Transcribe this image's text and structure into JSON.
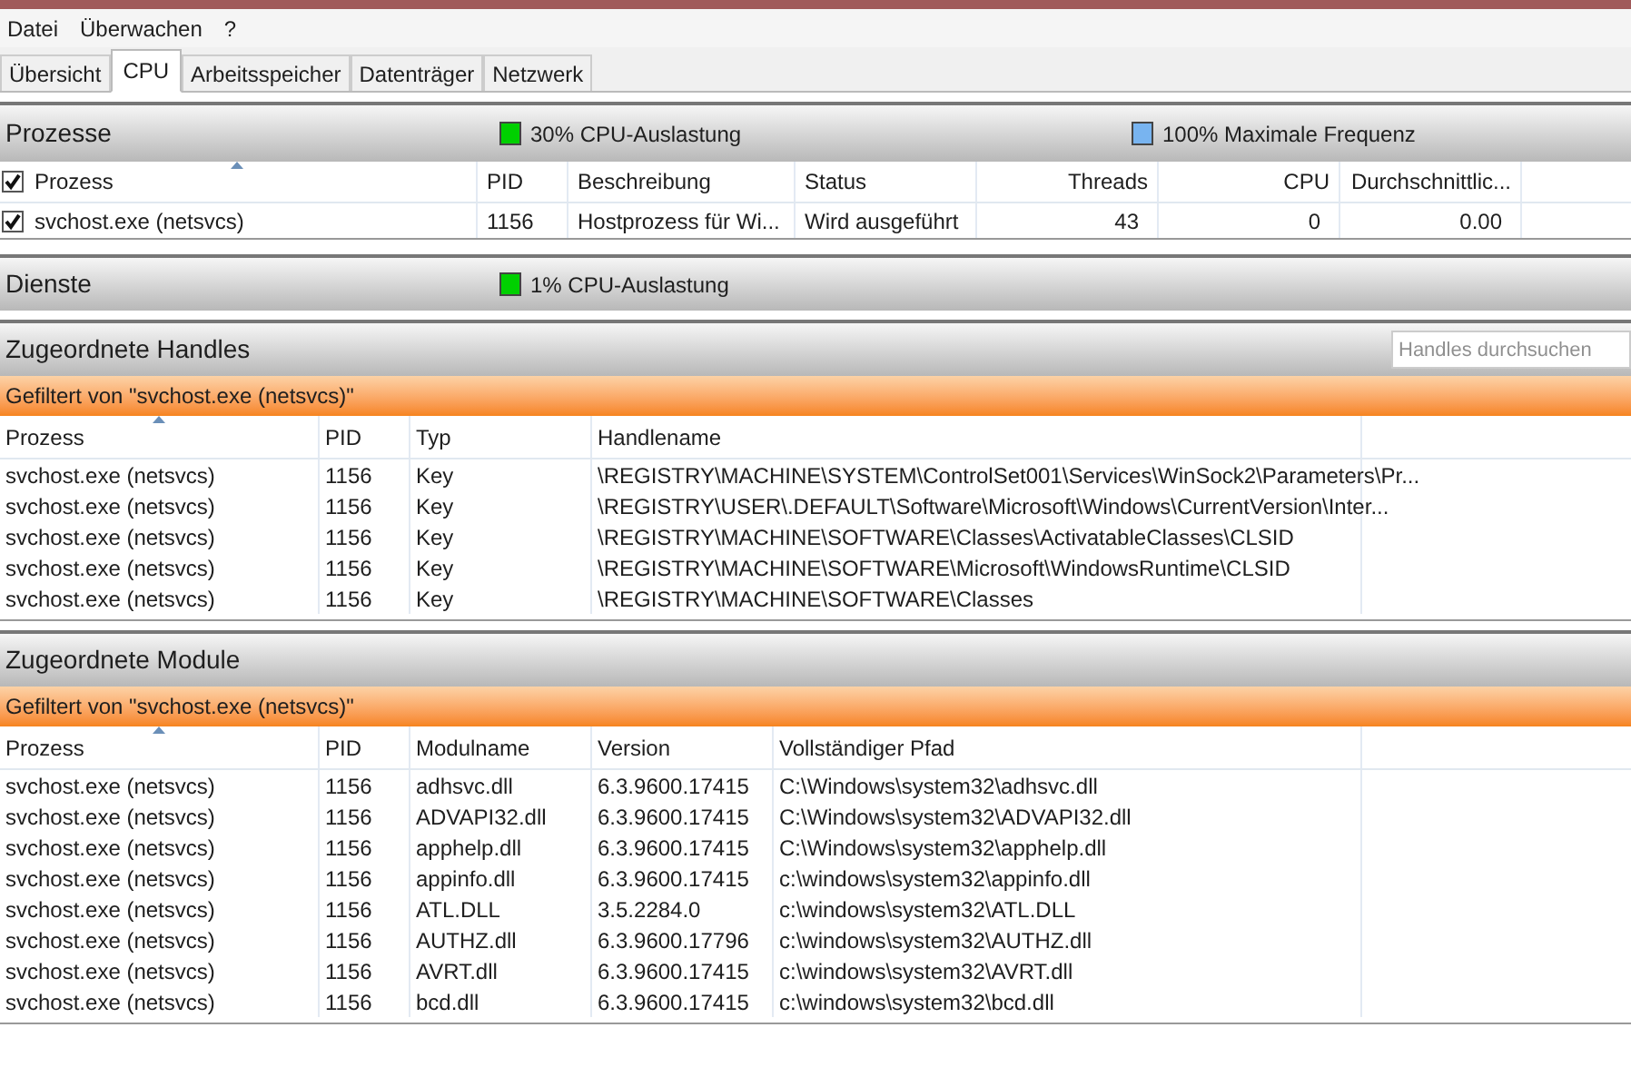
{
  "menu": [
    "Datei",
    "Überwachen",
    "?"
  ],
  "tabs": [
    {
      "label": "Übersicht",
      "selected": false
    },
    {
      "label": "CPU",
      "selected": true
    },
    {
      "label": "Arbeitsspeicher",
      "selected": false
    },
    {
      "label": "Datenträger",
      "selected": false
    },
    {
      "label": "Netzwerk",
      "selected": false
    }
  ],
  "processes": {
    "title": "Prozesse",
    "indicators": [
      {
        "text": "30% CPU-Auslastung",
        "color": "#00d000"
      },
      {
        "text": "100% Maximale Frequenz",
        "color": "#78b4f0"
      }
    ],
    "header_checked": true,
    "columns": [
      {
        "label": "Prozess",
        "sorted": true
      },
      {
        "label": "PID",
        "sorted": false
      },
      {
        "label": "Beschreibung",
        "sorted": false
      },
      {
        "label": "Status",
        "sorted": false
      },
      {
        "label": "Threads",
        "sorted": false
      },
      {
        "label": "CPU",
        "sorted": false
      },
      {
        "label": "Durchschnittlic...",
        "sorted": false
      }
    ],
    "rows": [
      {
        "checked": true,
        "cells": [
          "svchost.exe (netsvcs)",
          "1156",
          "Hostprozess für Wi...",
          "Wird ausgeführt",
          "43",
          "0",
          "0.00"
        ]
      }
    ]
  },
  "services": {
    "title": "Dienste",
    "indicators": [
      {
        "text": "1% CPU-Auslastung",
        "color": "#00d000"
      }
    ]
  },
  "handles": {
    "title": "Zugeordnete Handles",
    "search": {
      "placeholder": "Handles durchsuchen"
    },
    "filter": "Gefiltert von \"svchost.exe (netsvcs)\"",
    "columns": [
      {
        "label": "Prozess",
        "sorted": true
      },
      {
        "label": "PID",
        "sorted": false
      },
      {
        "label": "Typ",
        "sorted": false
      },
      {
        "label": "Handlename",
        "sorted": false
      }
    ],
    "rows": [
      [
        "svchost.exe (netsvcs)",
        "1156",
        "Key",
        "\\REGISTRY\\MACHINE\\SYSTEM\\ControlSet001\\Services\\WinSock2\\Parameters\\Pr..."
      ],
      [
        "svchost.exe (netsvcs)",
        "1156",
        "Key",
        "\\REGISTRY\\USER\\.DEFAULT\\Software\\Microsoft\\Windows\\CurrentVersion\\Inter..."
      ],
      [
        "svchost.exe (netsvcs)",
        "1156",
        "Key",
        "\\REGISTRY\\MACHINE\\SOFTWARE\\Classes\\ActivatableClasses\\CLSID"
      ],
      [
        "svchost.exe (netsvcs)",
        "1156",
        "Key",
        "\\REGISTRY\\MACHINE\\SOFTWARE\\Microsoft\\WindowsRuntime\\CLSID"
      ],
      [
        "svchost.exe (netsvcs)",
        "1156",
        "Key",
        "\\REGISTRY\\MACHINE\\SOFTWARE\\Classes"
      ]
    ]
  },
  "modules": {
    "title": "Zugeordnete Module",
    "filter": "Gefiltert von \"svchost.exe (netsvcs)\"",
    "columns": [
      {
        "label": "Prozess",
        "sorted": true
      },
      {
        "label": "PID",
        "sorted": false
      },
      {
        "label": "Modulname",
        "sorted": false
      },
      {
        "label": "Version",
        "sorted": false
      },
      {
        "label": "Vollständiger Pfad",
        "sorted": false
      }
    ],
    "rows": [
      [
        "svchost.exe (netsvcs)",
        "1156",
        "adhsvc.dll",
        "6.3.9600.17415",
        "C:\\Windows\\system32\\adhsvc.dll"
      ],
      [
        "svchost.exe (netsvcs)",
        "1156",
        "ADVAPI32.dll",
        "6.3.9600.17415",
        "C:\\Windows\\system32\\ADVAPI32.dll"
      ],
      [
        "svchost.exe (netsvcs)",
        "1156",
        "apphelp.dll",
        "6.3.9600.17415",
        "C:\\Windows\\system32\\apphelp.dll"
      ],
      [
        "svchost.exe (netsvcs)",
        "1156",
        "appinfo.dll",
        "6.3.9600.17415",
        "c:\\windows\\system32\\appinfo.dll"
      ],
      [
        "svchost.exe (netsvcs)",
        "1156",
        "ATL.DLL",
        "3.5.2284.0",
        "c:\\windows\\system32\\ATL.DLL"
      ],
      [
        "svchost.exe (netsvcs)",
        "1156",
        "AUTHZ.dll",
        "6.3.9600.17796",
        "c:\\windows\\system32\\AUTHZ.dll"
      ],
      [
        "svchost.exe (netsvcs)",
        "1156",
        "AVRT.dll",
        "6.3.9600.17415",
        "c:\\windows\\system32\\AVRT.dll"
      ],
      [
        "svchost.exe (netsvcs)",
        "1156",
        "bcd.dll",
        "6.3.9600.17415",
        "c:\\windows\\system32\\bcd.dll"
      ]
    ]
  }
}
